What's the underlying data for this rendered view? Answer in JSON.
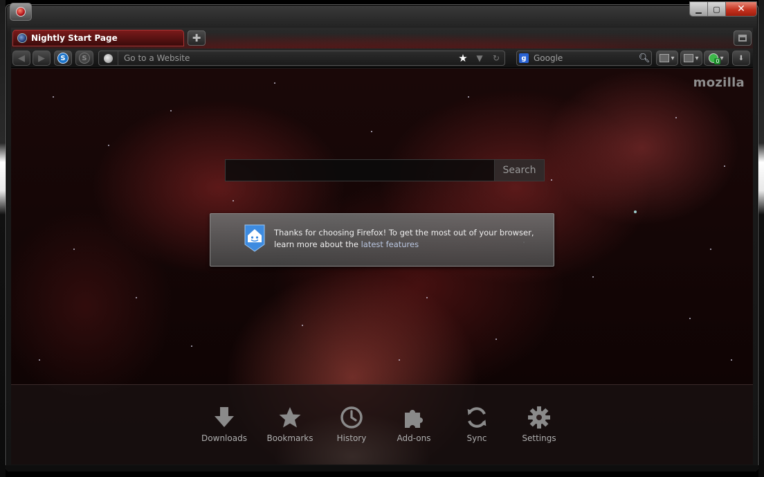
{
  "tab": {
    "title": "Nightly Start Page"
  },
  "window_controls": {
    "minimize": "▁",
    "maximize": "▢",
    "close": "✕"
  },
  "nav": {
    "url_placeholder": "Go to a Website",
    "search_engine_letter": "g",
    "search_placeholder": "Google",
    "addon_badge": "0"
  },
  "content": {
    "brand": "mozilla",
    "search_button": "Search",
    "snippet": {
      "text": "Thanks for choosing Firefox! To get the most out of your browser, learn more about the ",
      "link": "latest features"
    },
    "launcher": [
      {
        "label": "Downloads",
        "icon": "download-icon"
      },
      {
        "label": "Bookmarks",
        "icon": "star-icon"
      },
      {
        "label": "History",
        "icon": "clock-icon"
      },
      {
        "label": "Add-ons",
        "icon": "puzzle-icon"
      },
      {
        "label": "Sync",
        "icon": "sync-icon"
      },
      {
        "label": "Settings",
        "icon": "gear-icon"
      }
    ]
  },
  "colors": {
    "tab_accent": "#a33333",
    "search_engine": "#2a63d4",
    "close_button": "#c4321f"
  }
}
